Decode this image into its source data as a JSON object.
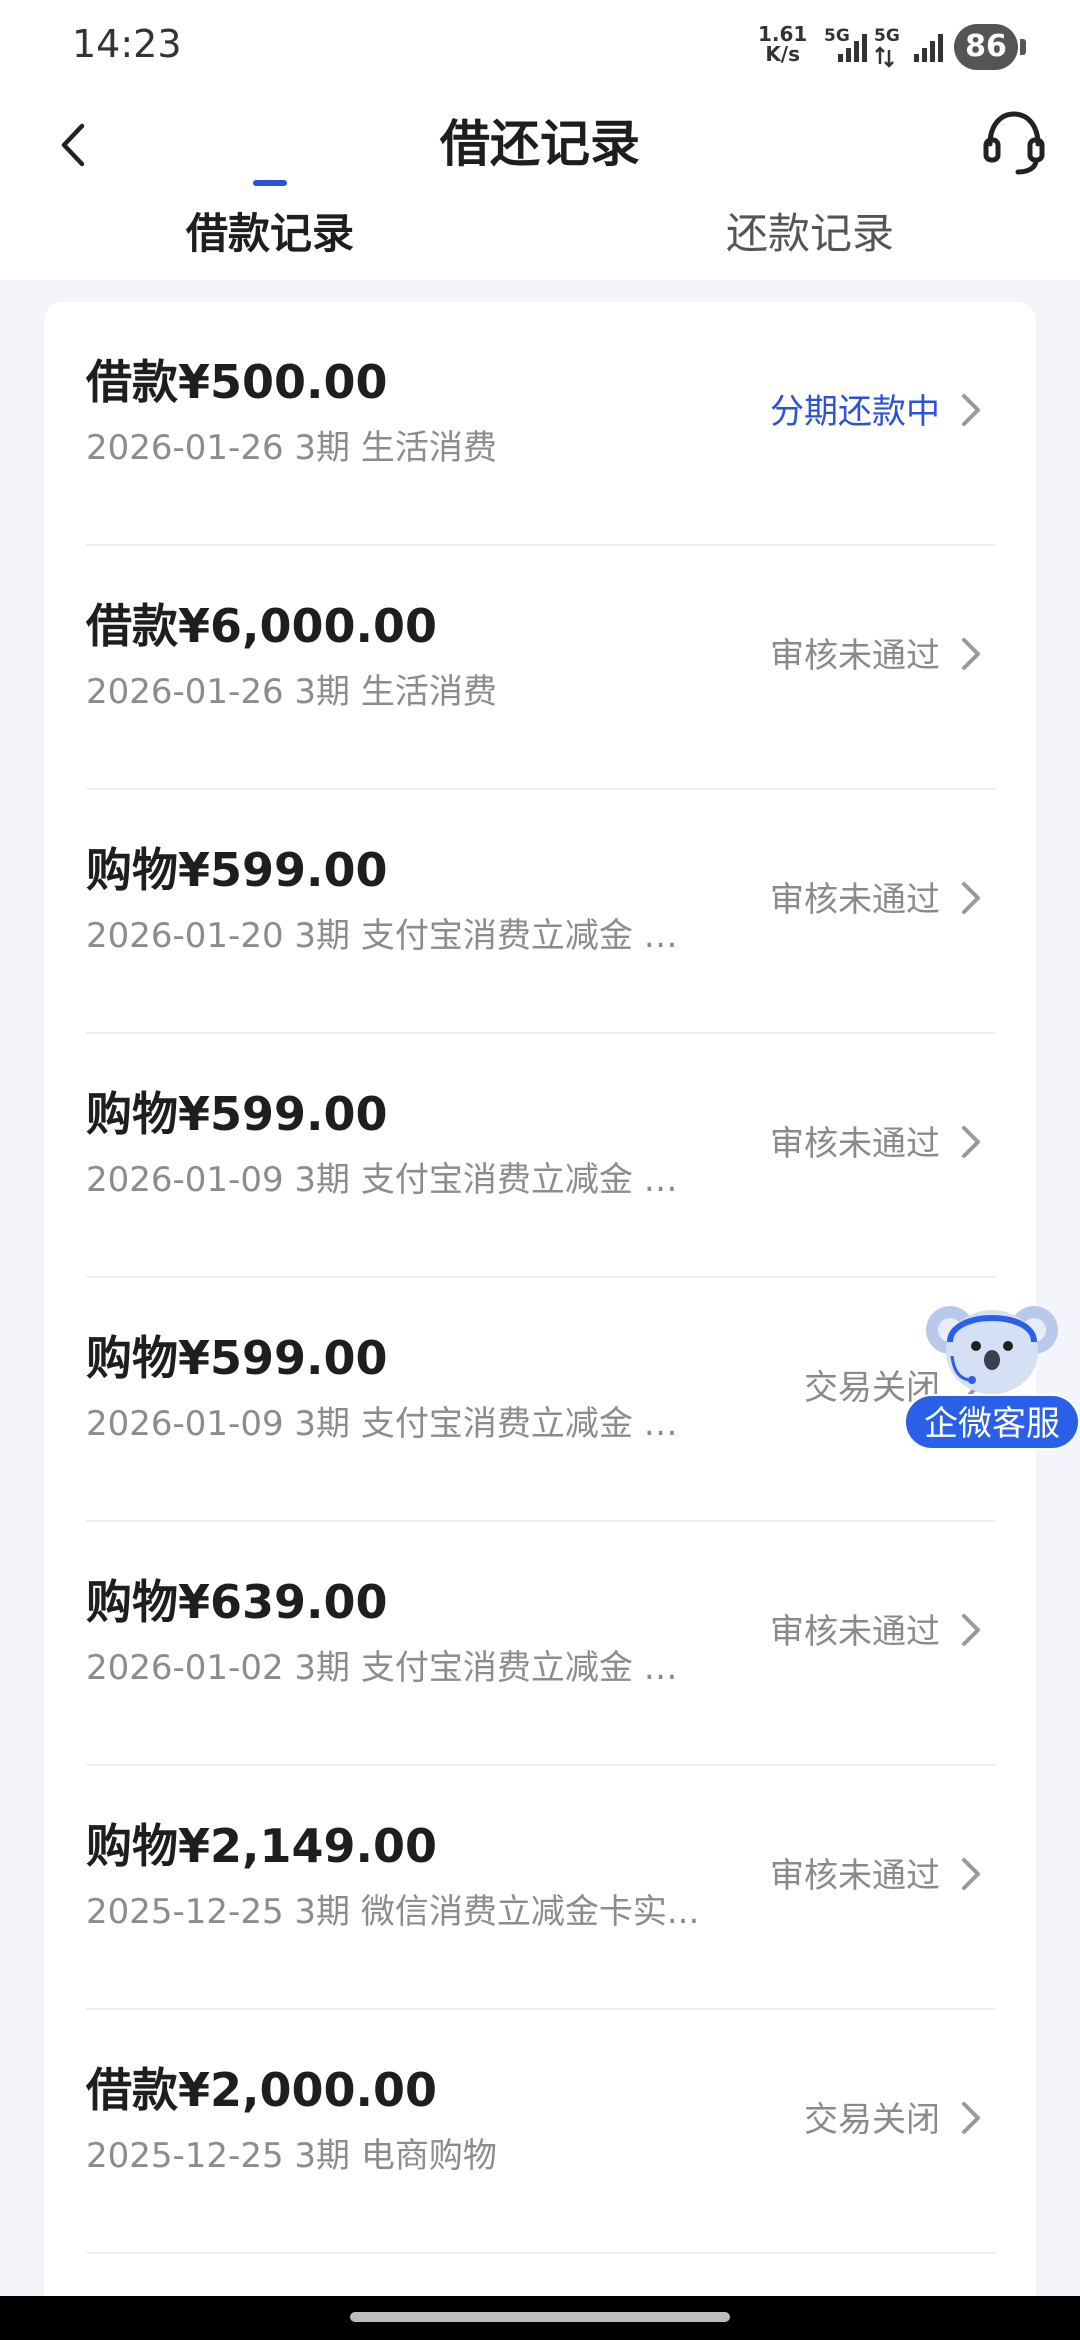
{
  "status_bar": {
    "time": "14:23",
    "net_speed_value": "1.61",
    "net_speed_unit": "K/s",
    "sim1_label": "5G",
    "sim2_label": "5G",
    "battery": "86"
  },
  "header": {
    "title": "借还记录",
    "back_icon": "chevron-left-icon",
    "service_icon": "headset-icon"
  },
  "tabs": [
    {
      "label": "借款记录",
      "active": true
    },
    {
      "label": "还款记录",
      "active": false
    }
  ],
  "records": [
    {
      "amount": "借款¥500.00",
      "detail": "2026-01-26 3期  生活消费",
      "status": "分期还款中",
      "status_color": "#2c52d6"
    },
    {
      "amount": "借款¥6,000.00",
      "detail": "2026-01-26 3期  生活消费",
      "status": "审核未通过",
      "status_color": "#8a8a8a"
    },
    {
      "amount": "购物¥599.00",
      "detail": "2026-01-20 3期  支付宝消费立减金 消...",
      "status": "审核未通过",
      "status_color": "#8a8a8a"
    },
    {
      "amount": "购物¥599.00",
      "detail": "2026-01-09 3期  支付宝消费立减金 消...",
      "status": "审核未通过",
      "status_color": "#8a8a8a"
    },
    {
      "amount": "购物¥599.00",
      "detail": "2026-01-09 3期  支付宝消费立减金 消...",
      "status": "交易关闭",
      "status_color": "#8a8a8a"
    },
    {
      "amount": "购物¥639.00",
      "detail": "2026-01-02 3期  支付宝消费立减金 消...",
      "status": "审核未通过",
      "status_color": "#8a8a8a"
    },
    {
      "amount": "购物¥2,149.00",
      "detail": "2025-12-25 3期  微信消费立减金卡实...",
      "status": "审核未通过",
      "status_color": "#8a8a8a"
    },
    {
      "amount": "借款¥2,000.00",
      "detail": "2025-12-25 3期  电商购物",
      "status": "交易关闭",
      "status_color": "#8a8a8a"
    }
  ],
  "floating_service": {
    "label": "企微客服",
    "icon": "koala-mascot-icon"
  },
  "colors": {
    "accent": "#2c52d6",
    "page_background": "#f3f5fa",
    "float_button": "#2a5fe8"
  }
}
